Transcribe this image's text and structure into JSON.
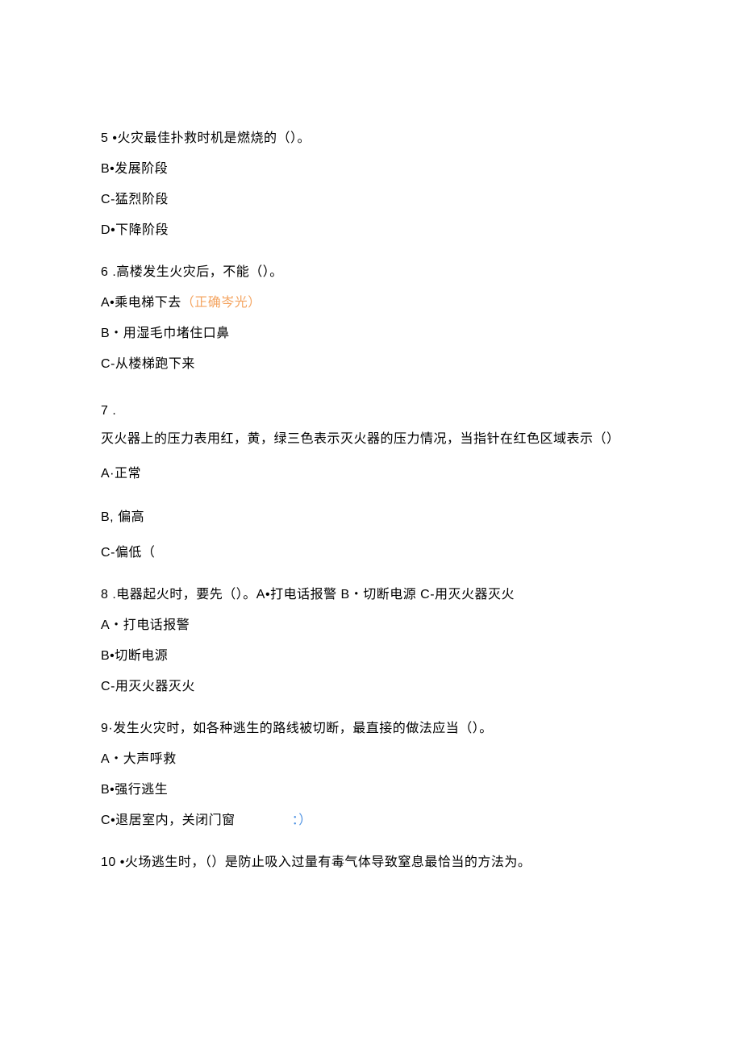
{
  "questions": [
    {
      "id": "q5",
      "number": "5",
      "sep": "  •",
      "stem": "火灾最佳扑救时机是燃烧的（）。",
      "options": [
        {
          "letter": "B",
          "sep": "•",
          "text": "发展阶段",
          "annotation": null
        },
        {
          "letter": "C",
          "sep": "-",
          "text": "猛烈阶段",
          "annotation": null
        },
        {
          "letter": "D",
          "sep": "•",
          "text": "下降阶段",
          "annotation": null
        }
      ]
    },
    {
      "id": "q6",
      "number": "6",
      "sep": "  .",
      "stem": "高楼发生火灾后，不能（）。",
      "options": [
        {
          "letter": "A",
          "sep": "•",
          "text": "乘电梯下去",
          "annotation": "（正确岑光）",
          "annotClass": "annotation"
        },
        {
          "letter": "B",
          "sep": "・",
          "text": "用湿毛巾堵住口鼻",
          "annotation": null
        },
        {
          "letter": "C",
          "sep": "-",
          "text": "从楼梯跑下来",
          "annotation": null
        }
      ]
    },
    {
      "id": "q7",
      "number": "7",
      "sep": "  .",
      "stem": "灭火器上的压力表用红，黄，绿三色表示灭火器的压力情况，当指针在红色区域表示（）",
      "options": [
        {
          "letter": "A",
          "sep": "·",
          "text": "正常",
          "annotation": null,
          "extraGap": false
        },
        {
          "letter": "B",
          "sep": ", ",
          "text": "偏高",
          "annotation": null,
          "extraGap": true
        },
        {
          "letter": "C",
          "sep": "-",
          "text": "偏低（",
          "annotation": null,
          "extraGap": false
        }
      ]
    },
    {
      "id": "q8",
      "number": "8",
      "sep": "  .",
      "stem": "电器起火时，要先（）。A•打电话报警 B・切断电源 C-用灭火器灭火",
      "options": [
        {
          "letter": "A",
          "sep": "・",
          "text": "打电话报警",
          "annotation": null
        },
        {
          "letter": "B",
          "sep": "•",
          "text": "切断电源",
          "annotation": null
        },
        {
          "letter": "C",
          "sep": "-",
          "text": "用灭火器灭火",
          "annotation": null
        }
      ]
    },
    {
      "id": "q9",
      "number": "9",
      "sep": "·",
      "stem": "发生火灾时，如各种逃生的路线被切断，最直接的做法应当（）。",
      "options": [
        {
          "letter": "A",
          "sep": "・",
          "text": "大声呼救",
          "annotation": null
        },
        {
          "letter": "B",
          "sep": "•",
          "text": "强行逃生",
          "annotation": null
        },
        {
          "letter": "C",
          "sep": "•",
          "text": "退居室内，关闭门窗",
          "annotation": "：）",
          "annotClass": "annotation-blue",
          "annotPad": true
        }
      ]
    },
    {
      "id": "q10",
      "number": "10",
      "sep": "  •",
      "stem": "火场逃生时，（）是防止吸入过量有毒气体导致窒息最恰当的方法为。",
      "options": []
    }
  ]
}
